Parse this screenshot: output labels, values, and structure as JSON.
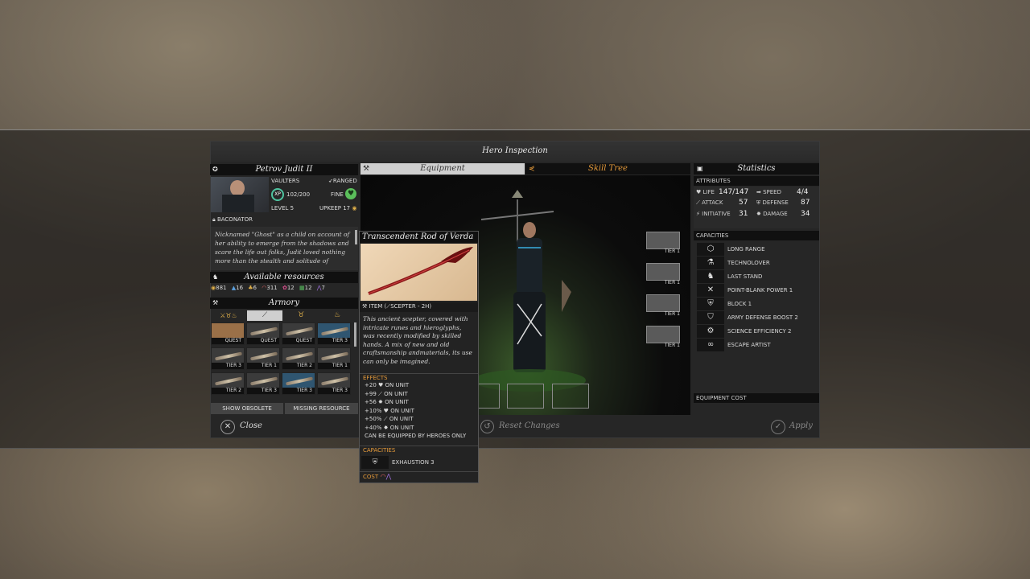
{
  "window": {
    "title": "Hero Inspection"
  },
  "hero": {
    "name": "Petrov Judit II",
    "faction": "VAULTERS",
    "attack_type": "RANGED",
    "xp": "102/200",
    "xp_label": "XP",
    "status": "FINE",
    "level": "LEVEL 5",
    "upkeep": "UPKEEP 17",
    "title": "BACONATOR",
    "bio": "Nicknamed \"Ghost\" as a child on account of her ability to emerge from the shadows and scare the life out folks, Judit loved nothing more than the stealth and solitude of"
  },
  "resources": {
    "header": "Available resources",
    "items": [
      {
        "icon": "dust-icon",
        "value": "881"
      },
      {
        "icon": "glassteel-icon",
        "value": "16"
      },
      {
        "icon": "titanium-icon",
        "value": "6"
      },
      {
        "icon": "hyperium-icon",
        "value": "311"
      },
      {
        "icon": "adamantian-icon",
        "value": "12"
      },
      {
        "icon": "palladian-icon",
        "value": "12"
      },
      {
        "icon": "antimatter-icon",
        "value": "7"
      }
    ]
  },
  "armory": {
    "header": "Armory",
    "rows": [
      [
        "QUEST",
        "QUEST",
        "QUEST",
        "TIER 3"
      ],
      [
        "TIER 3",
        "TIER 1",
        "TIER 2",
        "TIER 1"
      ],
      [
        "TIER 2",
        "TIER 3",
        "TIER 3",
        "TIER 3"
      ]
    ],
    "show_obsolete": "SHOW OBSOLETE",
    "missing_resource": "MISSING RESOURCE"
  },
  "tabs": {
    "equipment": "Equipment",
    "skill_tree": "Skill Tree"
  },
  "equipped": [
    "TIER 1",
    "TIER 1",
    "TIER 1",
    "TIER 1"
  ],
  "statistics": {
    "header": "Statistics",
    "attributes_label": "ATTRIBUTES",
    "life_label": "LIFE",
    "life_value": "147/147",
    "speed_label": "SPEED",
    "speed_value": "4/4",
    "attack_label": "ATTACK",
    "attack_value": "57",
    "defense_label": "DEFENSE",
    "defense_value": "87",
    "initiative_label": "INITIATIVE",
    "initiative_value": "31",
    "damage_label": "DAMAGE",
    "damage_value": "34",
    "capacities_label": "CAPACITIES",
    "capacities": [
      "LONG RANGE",
      "TECHNOLOVER",
      "LAST STAND",
      "POINT-BLANK POWER 1",
      "BLOCK 1",
      "ARMY DEFENSE BOOST 2",
      "SCIENCE EFFICIENCY 2",
      "ESCAPE ARTIST"
    ],
    "equipment_cost": "EQUIPMENT COST"
  },
  "footer": {
    "close": "Close",
    "reset": "Reset Changes",
    "apply": "Apply"
  },
  "tooltip": {
    "name": "Transcendent Rod of Verda",
    "item_type_prefix": "ITEM (",
    "item_type": "SCEPTER - 2H)",
    "description": "This ancient scepter, covered with intricate runes and hieroglyphs, was recently modified by skilled hands. A mix of new and old craftsmanship andmaterials, its use can only be imagined.",
    "effects_label": "EFFECTS",
    "effects": [
      "+20",
      "+99",
      "+56",
      "+10%",
      "+50%",
      "+40%"
    ],
    "on_unit": "ON UNIT",
    "equip_note": "CAN BE EQUIPPED BY HEROES ONLY",
    "capacities_label": "CAPACITIES",
    "capacity": "EXHAUSTION 3",
    "cost_label": "COST"
  },
  "colors": {
    "accent": "#e59a3a",
    "xp_ring": "#4fc3a0",
    "fine": "#5bbf5b"
  }
}
